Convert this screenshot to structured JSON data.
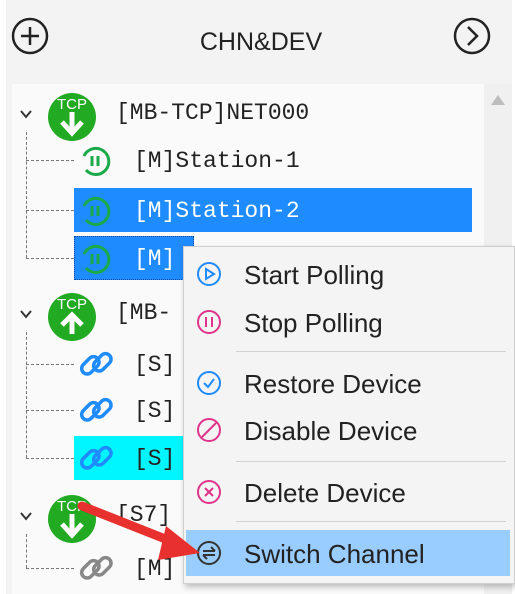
{
  "header": {
    "title": "CHN&DEV",
    "add_icon": "plus-circle-icon",
    "next_icon": "chevron-right-circle-icon"
  },
  "tree": {
    "channels": [
      {
        "label": "[MB-TCP]NET000",
        "badge": "TCP",
        "badge_color": "#22aa22",
        "devices": [
          {
            "label": "[M]Station-1",
            "icon": "polling-icon",
            "state": "normal"
          },
          {
            "label": "[M]Station-2",
            "icon": "polling-icon",
            "state": "selected"
          },
          {
            "label": "[M]",
            "icon": "polling-icon",
            "state": "focused"
          }
        ]
      },
      {
        "label": "[MB-",
        "badge": "TCP",
        "badge_color": "#22aa22",
        "devices": [
          {
            "label": "[S]",
            "icon": "link-icon",
            "state": "normal"
          },
          {
            "label": "[S]",
            "icon": "link-icon",
            "state": "normal"
          },
          {
            "label": "[S]",
            "icon": "link-icon",
            "state": "highlighted"
          }
        ]
      },
      {
        "label": "[S7]",
        "badge": "TCP",
        "badge_color": "#22aa22",
        "devices": [
          {
            "label": "[M]",
            "icon": "link-icon-gray",
            "state": "normal"
          }
        ]
      }
    ]
  },
  "context_menu": {
    "items": [
      {
        "label": "Start Polling",
        "icon": "play-circle-icon",
        "color": "#1e8bff"
      },
      {
        "label": "Stop Polling",
        "icon": "pause-circle-icon",
        "color": "#e0338c"
      },
      {
        "label": "Restore Device",
        "icon": "check-circle-icon",
        "color": "#1e8bff"
      },
      {
        "label": "Disable Device",
        "icon": "ban-circle-icon",
        "color": "#e0338c"
      },
      {
        "label": "Delete Device",
        "icon": "x-circle-icon",
        "color": "#e0338c"
      },
      {
        "label": "Switch Channel",
        "icon": "switch-circle-icon",
        "color": "#333333"
      }
    ],
    "highlighted_item": "Switch Channel"
  },
  "colors": {
    "selection": "#1e8bff",
    "highlight_cyan": "#00f6ff",
    "menu_hover": "#99ccff",
    "arrow": "#e8312f"
  }
}
